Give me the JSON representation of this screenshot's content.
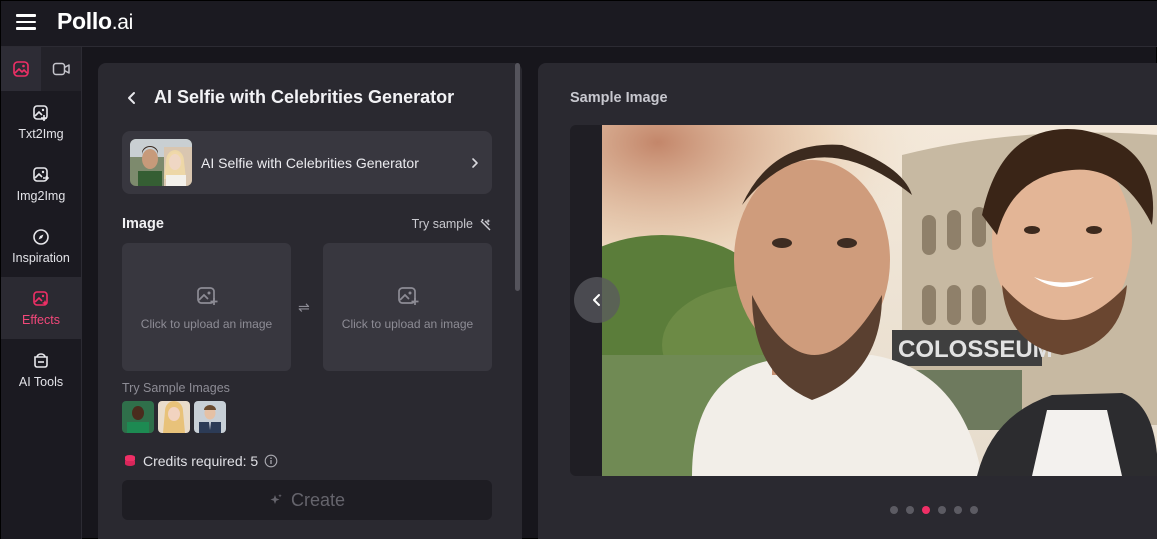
{
  "app": {
    "logo_main": "Pollo",
    "logo_suffix": ".ai"
  },
  "colors": {
    "accent": "#ef2f66",
    "panel": "#2a2930",
    "background": "#17161c"
  },
  "sidebar": {
    "tabs": [
      {
        "icon": "image-icon",
        "active": true
      },
      {
        "icon": "video-icon",
        "active": false
      }
    ],
    "items": [
      {
        "label": "Txt2Img",
        "icon": "text-to-image-icon"
      },
      {
        "label": "Img2Img",
        "icon": "image-to-image-icon"
      },
      {
        "label": "Inspiration",
        "icon": "compass-icon"
      },
      {
        "label": "Effects",
        "icon": "effects-icon",
        "active": true
      },
      {
        "label": "AI Tools",
        "icon": "ai-tools-icon"
      }
    ]
  },
  "panel": {
    "title": "AI Selfie with Celebrities Generator",
    "effect_card": {
      "name": "AI Selfie with Celebrities Generator"
    },
    "image_section": {
      "title": "Image",
      "try_sample": "Try sample"
    },
    "upload_slots": [
      {
        "hint": "Click to upload an image"
      },
      {
        "hint": "Click to upload an image"
      }
    ],
    "swap_symbol": "⇌",
    "samples_label": "Try Sample Images",
    "credits_label": "Credits required: 5",
    "create_label": "Create"
  },
  "preview": {
    "title": "Sample Image",
    "sign_text": "COLOSSEUM",
    "slide_count": 6,
    "active_slide": 3
  }
}
